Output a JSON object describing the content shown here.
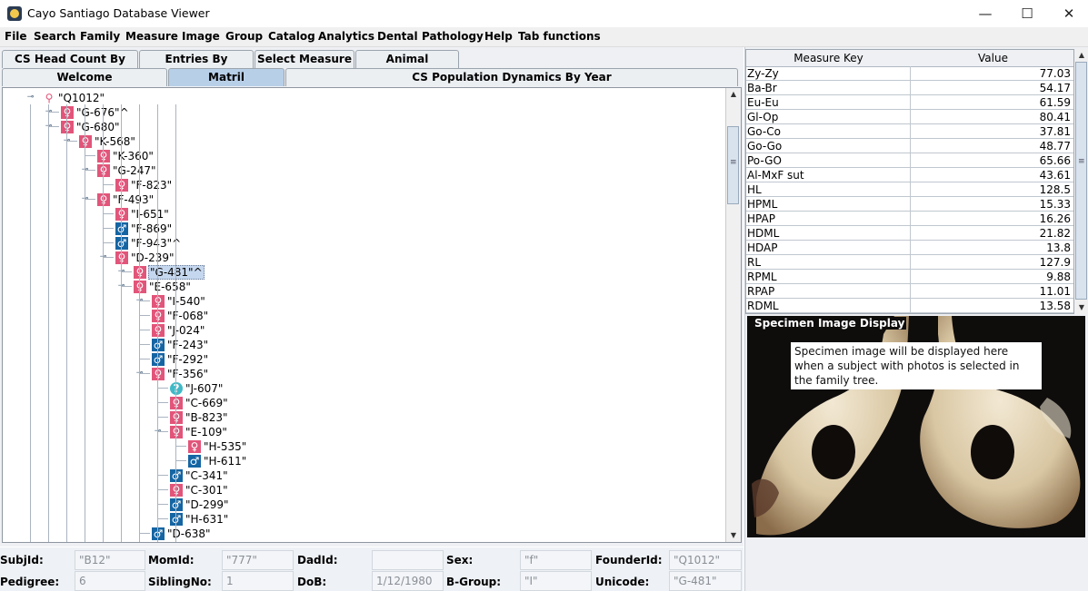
{
  "window": {
    "title": "Cayo Santiago Database Viewer",
    "minimize": "—",
    "maximize": "☐",
    "close": "✕"
  },
  "menu": [
    "File",
    "Search",
    "Family",
    "Measure",
    "Image",
    "Group",
    "Catalog",
    "Analytics",
    "Dental",
    "Pathology",
    "Help",
    "Tab functions"
  ],
  "tabs_row1": [
    "CS Head Count By Year",
    "Entries By Founder",
    "Select Measure",
    "Animal Selection"
  ],
  "tabs_row2": [
    "Welcome",
    "Matril",
    "CS Population Dynamics By Year"
  ],
  "active_tab": "Matril",
  "tree_nodes": [
    {
      "label": "\"Q1012\"",
      "sex": "root"
    },
    {
      "label": "\"G-676\"^",
      "sex": "f"
    },
    {
      "label": "\"G-680\"",
      "sex": "f"
    },
    {
      "label": "\"K-568\"",
      "sex": "f"
    },
    {
      "label": "\"K-360\"",
      "sex": "f"
    },
    {
      "label": "\"G-247\"",
      "sex": "f"
    },
    {
      "label": "\"F-823\"",
      "sex": "f"
    },
    {
      "label": "\"F-493\"",
      "sex": "f"
    },
    {
      "label": "\"I-651\"",
      "sex": "f"
    },
    {
      "label": "\"F-869\"",
      "sex": "m"
    },
    {
      "label": "\"F-943\"^",
      "sex": "m"
    },
    {
      "label": "\"D-239\"",
      "sex": "f"
    },
    {
      "label": "\"G-481\"^",
      "sex": "f",
      "selected": true
    },
    {
      "label": "\"E-658\"",
      "sex": "f"
    },
    {
      "label": "\"I-540\"",
      "sex": "f"
    },
    {
      "label": "\"F-068\"",
      "sex": "f"
    },
    {
      "label": "\"J-024\"",
      "sex": "f"
    },
    {
      "label": "\"F-243\"",
      "sex": "m"
    },
    {
      "label": "\"F-292\"",
      "sex": "m"
    },
    {
      "label": "\"F-356\"",
      "sex": "f"
    },
    {
      "label": "\"J-607\"",
      "sex": "q"
    },
    {
      "label": "\"C-669\"",
      "sex": "f"
    },
    {
      "label": "\"B-823\"",
      "sex": "f"
    },
    {
      "label": "\"E-109\"",
      "sex": "f"
    },
    {
      "label": "\"H-535\"",
      "sex": "f"
    },
    {
      "label": "\"H-611\"",
      "sex": "m"
    },
    {
      "label": "\"C-341\"",
      "sex": "m"
    },
    {
      "label": "\"C-301\"",
      "sex": "f"
    },
    {
      "label": "\"D-299\"",
      "sex": "m"
    },
    {
      "label": "\"H-631\"",
      "sex": "m"
    },
    {
      "label": "\"D-638\"",
      "sex": "m"
    }
  ],
  "icons": {
    "f": "♀",
    "m": "♂",
    "q": "?",
    "root": "⚲"
  },
  "measure_table": {
    "headers": [
      "Measure Key",
      "Value"
    ],
    "rows": [
      [
        "Zy-Zy",
        "77.03"
      ],
      [
        "Ba-Br",
        "54.17"
      ],
      [
        "Eu-Eu",
        "61.59"
      ],
      [
        "Gl-Op",
        "80.41"
      ],
      [
        "Go-Co",
        "37.81"
      ],
      [
        "Go-Go",
        "48.77"
      ],
      [
        "Po-GO",
        "65.66"
      ],
      [
        "Al-MxF sut",
        "43.61"
      ],
      [
        "HL",
        "128.5"
      ],
      [
        "HPML",
        "15.33"
      ],
      [
        "HPAP",
        "16.26"
      ],
      [
        "HDML",
        "21.82"
      ],
      [
        "HDAP",
        "13.8"
      ],
      [
        "RL",
        "127.9"
      ],
      [
        "RPML",
        "9.88"
      ],
      [
        "RPAP",
        "11.01"
      ],
      [
        "RDML",
        "13.58"
      ]
    ]
  },
  "specimen": {
    "legend": "Specimen Image Display",
    "notice": "Specimen image will be displayed here when a subject with photos is selected in the family tree."
  },
  "footer": {
    "subj_label": "SubjId:",
    "subj_value": "\"B12\"",
    "mom_label": "MomId:",
    "mom_value": "\"777\"",
    "dad_label": "DadId:",
    "dad_value": "",
    "sex_label": "Sex:",
    "sex_value": "\"f\"",
    "founder_label": "FounderId:",
    "founder_value": "\"Q1012\"",
    "pedigree_label": "Pedigree:",
    "pedigree_value": "6",
    "sibling_label": "SiblingNo:",
    "sibling_value": "1",
    "dob_label": "DoB:",
    "dob_value": "1/12/1980",
    "bgroup_label": "B-Group:",
    "bgroup_value": "\"I\"",
    "unicode_label": "Unicode:",
    "unicode_value": "\"G-481\""
  },
  "colors": {
    "female": "#e2557a",
    "male": "#1565a3",
    "unknown": "#41b9c6",
    "active_tab": "#b8cfe8"
  }
}
